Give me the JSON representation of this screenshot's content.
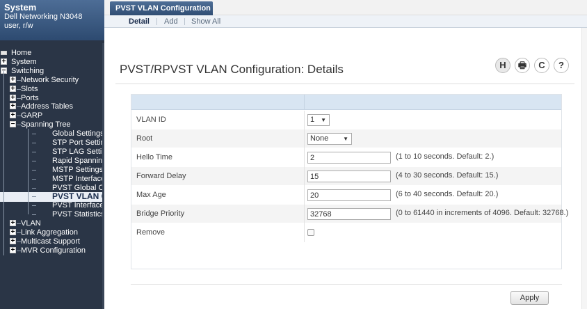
{
  "system": {
    "title": "System",
    "device": "Dell Networking N3048",
    "user": "user, r/w"
  },
  "nav": [
    {
      "label": "Home",
      "icon": "home-icon",
      "depth": 0,
      "box": ""
    },
    {
      "label": "System",
      "icon": "expand-icon",
      "depth": 0,
      "box": "+"
    },
    {
      "label": "Switching",
      "icon": "collapse-icon",
      "depth": 0,
      "box": "−"
    },
    {
      "label": "Network Security",
      "icon": "expand-icon",
      "depth": 1,
      "box": "+"
    },
    {
      "label": "Slots",
      "icon": "expand-icon",
      "depth": 1,
      "box": "+"
    },
    {
      "label": "Ports",
      "icon": "expand-icon",
      "depth": 1,
      "box": "+"
    },
    {
      "label": "Address Tables",
      "icon": "expand-icon",
      "depth": 1,
      "box": "+"
    },
    {
      "label": "GARP",
      "icon": "expand-icon",
      "depth": 1,
      "box": "+"
    },
    {
      "label": "Spanning Tree",
      "icon": "collapse-icon",
      "depth": 1,
      "box": "−"
    },
    {
      "label": "Global Settings",
      "icon": "",
      "depth": 2,
      "box": ""
    },
    {
      "label": "STP Port Settings",
      "icon": "",
      "depth": 2,
      "box": ""
    },
    {
      "label": "STP LAG Settings",
      "icon": "",
      "depth": 2,
      "box": ""
    },
    {
      "label": "Rapid Spanning Tree",
      "icon": "",
      "depth": 2,
      "box": ""
    },
    {
      "label": "MSTP Settings",
      "icon": "",
      "depth": 2,
      "box": ""
    },
    {
      "label": "MSTP Interface Settings",
      "icon": "",
      "depth": 2,
      "box": ""
    },
    {
      "label": "PVST Global Configuration",
      "icon": "",
      "depth": 2,
      "box": ""
    },
    {
      "label": "PVST VLAN Configuration",
      "icon": "",
      "depth": 2,
      "box": "",
      "selected": true
    },
    {
      "label": "PVST Interface Configuration",
      "icon": "",
      "depth": 2,
      "box": ""
    },
    {
      "label": "PVST Statistics",
      "icon": "",
      "depth": 2,
      "box": ""
    },
    {
      "label": "VLAN",
      "icon": "expand-icon",
      "depth": 1,
      "box": "+"
    },
    {
      "label": "Link Aggregation",
      "icon": "expand-icon",
      "depth": 1,
      "box": "+"
    },
    {
      "label": "Multicast Support",
      "icon": "expand-icon",
      "depth": 1,
      "box": "+"
    },
    {
      "label": "MVR Configuration",
      "icon": "expand-icon",
      "depth": 1,
      "box": "+"
    }
  ],
  "tabs": {
    "active": "PVST VLAN Configuration",
    "sub": [
      "Detail",
      "Add",
      "Show All"
    ]
  },
  "page": {
    "title": "PVST/RPVST VLAN Configuration: Details",
    "header_icons": [
      {
        "name": "save-icon",
        "glyph": "H"
      },
      {
        "name": "print-icon",
        "glyph": "🖶"
      },
      {
        "name": "refresh-icon",
        "glyph": "C"
      },
      {
        "name": "help-icon",
        "glyph": "?"
      }
    ]
  },
  "form": {
    "vlan_id": {
      "label": "VLAN ID",
      "value": "1"
    },
    "root": {
      "label": "Root",
      "value": "None"
    },
    "hello_time": {
      "label": "Hello Time",
      "value": "2",
      "hint": "(1 to 10 seconds. Default: 2.)"
    },
    "forward_delay": {
      "label": "Forward Delay",
      "value": "15",
      "hint": "(4 to 30 seconds. Default: 15.)"
    },
    "max_age": {
      "label": "Max Age",
      "value": "20",
      "hint": "(6 to 40 seconds. Default: 20.)"
    },
    "bridge_priority": {
      "label": "Bridge Priority",
      "value": "32768",
      "hint": "(0 to 61440 in increments of 4096. Default: 32768.)"
    },
    "remove": {
      "label": "Remove",
      "checked": false
    }
  },
  "apply_label": "Apply",
  "colors": {
    "sidebar": "#2a3546",
    "header_blue": "#2d4a70",
    "table_head": "#d8e5f2"
  }
}
